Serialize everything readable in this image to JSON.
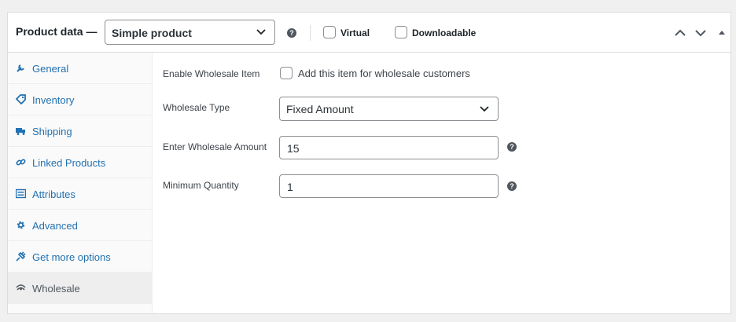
{
  "header": {
    "title": "Product data —",
    "product_type": "Simple product",
    "virtual_label": "Virtual",
    "downloadable_label": "Downloadable"
  },
  "tabs": [
    {
      "label": "General",
      "icon": "wrench-icon"
    },
    {
      "label": "Inventory",
      "icon": "tag-icon"
    },
    {
      "label": "Shipping",
      "icon": "truck-icon"
    },
    {
      "label": "Linked Products",
      "icon": "link-icon"
    },
    {
      "label": "Attributes",
      "icon": "list-icon"
    },
    {
      "label": "Advanced",
      "icon": "gear-icon"
    },
    {
      "label": "Get more options",
      "icon": "plugin-icon"
    },
    {
      "label": "Wholesale",
      "icon": "wholesale-icon",
      "active": true
    }
  ],
  "wholesale": {
    "enable_label": "Enable Wholesale Item",
    "enable_checkbox_label": "Add this item for wholesale customers",
    "type_label": "Wholesale Type",
    "type_value": "Fixed Amount",
    "amount_label": "Enter Wholesale Amount",
    "amount_value": "15",
    "min_qty_label": "Minimum Quantity",
    "min_qty_value": "1"
  },
  "colors": {
    "link": "#2271b1",
    "border": "#dcdcde",
    "help_icon": "#50575e"
  }
}
